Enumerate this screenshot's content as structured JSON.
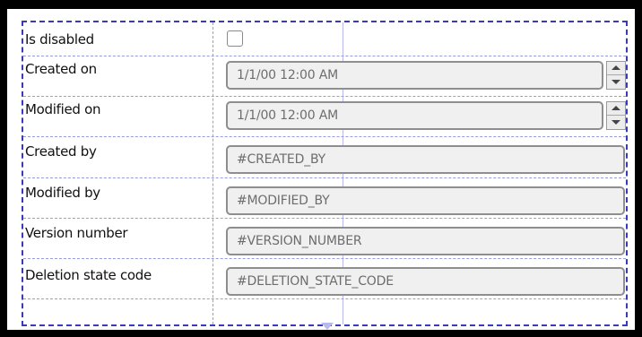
{
  "form": {
    "rows": [
      {
        "label": "Is disabled",
        "control": "checkbox",
        "checked": false
      },
      {
        "label": "Created on",
        "control": "datetime",
        "value": "1/1/00 12:00 AM"
      },
      {
        "label": "Modified on",
        "control": "datetime",
        "value": "1/1/00 12:00 AM"
      },
      {
        "label": "Created by",
        "control": "text",
        "value": "#CREATED_BY"
      },
      {
        "label": "Modified by",
        "control": "text",
        "value": "#MODIFIED_BY"
      },
      {
        "label": "Version number",
        "control": "text",
        "value": "#VERSION_NUMBER"
      },
      {
        "label": "Deletion state code",
        "control": "text",
        "value": "#DELETION_STATE_CODE"
      }
    ]
  },
  "colors": {
    "selection_border": "#3a3ab5",
    "guide_line": "#9a9ae0",
    "field_background": "#f0f0f0",
    "field_text": "#6d6d6d"
  },
  "icons": {
    "spin_up": "arrow-up-icon",
    "spin_down": "arrow-down-icon"
  }
}
